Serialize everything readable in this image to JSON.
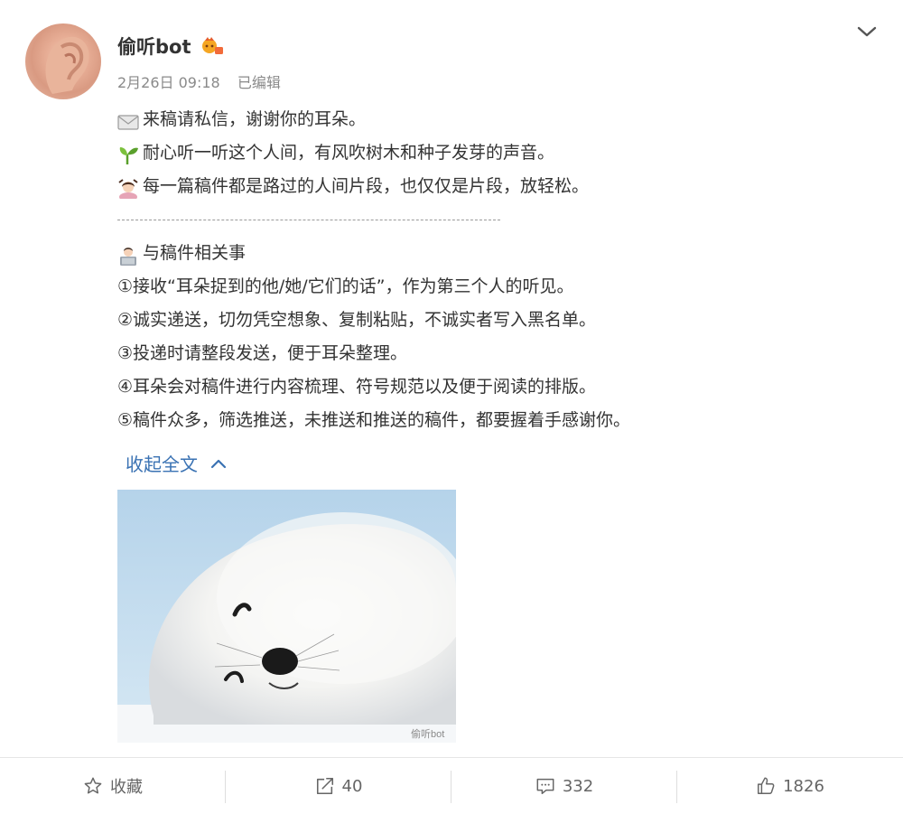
{
  "post": {
    "username": "偷听bot",
    "date": "2月26日 09:18",
    "edited": "已编辑",
    "lines": [
      "来稿请私信，谢谢你的耳朵。",
      "耐心听一听这个人间，有风吹树木和种子发芽的声音。",
      "每一篇稿件都是路过的人间片段，也仅仅是片段，放轻松。",
      "----------------------------------------------------------------------",
      "与稿件相关事",
      "①接收“耳朵捉到的他/她/它们的话”，作为第三个人的听见。",
      "②诚实递送，切勿凭空想象、复制粘贴，不诚实者写入黑名单。",
      "③投递时请整段发送，便于耳朵整理。",
      "④耳朵会对稿件进行内容梳理、符号规范以及便于阅读的排版。",
      "⑤稿件众多，筛选推送，未推送和推送的稿件，都要握着手感谢你。"
    ],
    "collapse_label": "收起全文",
    "image_alt": "sleeping white seal pup",
    "watermark": "偷听bot"
  },
  "actions": {
    "favorite": "收藏",
    "repost": "40",
    "comment": "332",
    "like": "1826"
  },
  "icons": {
    "line0": "envelope-icon",
    "line1": "seedling-icon",
    "line2": "person-gesturing-icon",
    "line4": "person-laptop-icon"
  }
}
